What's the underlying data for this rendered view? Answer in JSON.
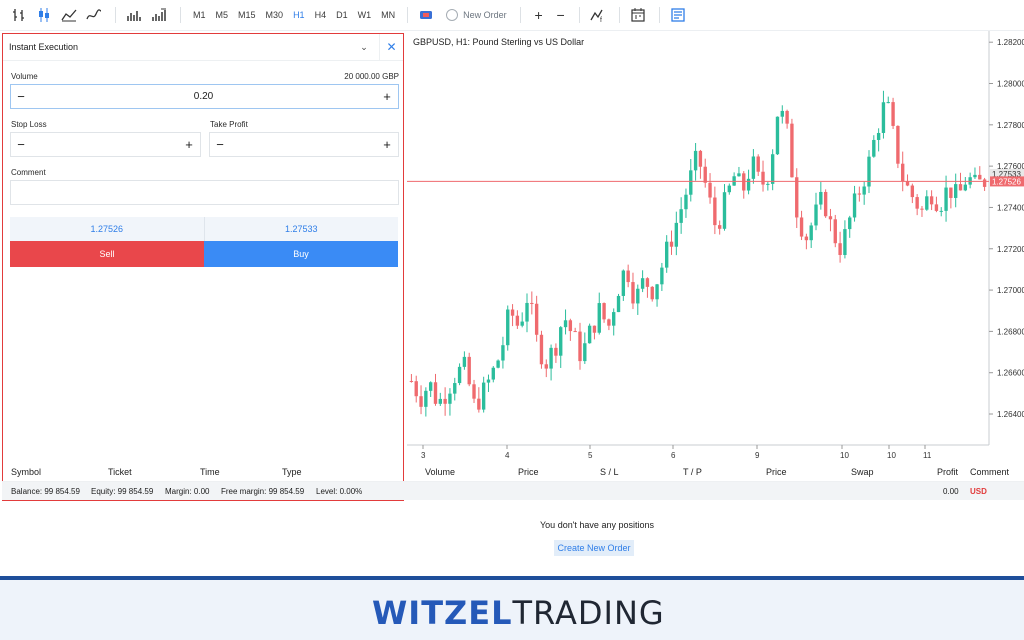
{
  "toolbar": {
    "timeframes": [
      "M1",
      "M5",
      "M15",
      "M30",
      "H1",
      "H4",
      "D1",
      "W1",
      "MN"
    ],
    "active_timeframe": "H1",
    "new_order_label": "New Order"
  },
  "panel": {
    "title": "Instant Execution",
    "volume_label": "Volume",
    "volume_amount": "20 000.00 GBP",
    "volume_value": "0.20",
    "stop_loss_label": "Stop Loss",
    "take_profit_label": "Take Profit",
    "comment_label": "Comment",
    "bid": "1.27526",
    "ask": "1.27533",
    "sell_label": "Sell",
    "buy_label": "Buy"
  },
  "chart_data": {
    "type": "candlestick",
    "title": "GBPUSD, H1: Pound Sterling vs US Dollar",
    "x_ticks": [
      "3",
      "4",
      "5",
      "6",
      "9",
      "10",
      "10",
      "11"
    ],
    "y_ticks": [
      "1.28200",
      "1.28000",
      "1.27800",
      "1.27600",
      "1.27400",
      "1.27200",
      "1.27000",
      "1.26800",
      "1.26600",
      "1.26400"
    ],
    "ylim": [
      1.2625,
      1.2823
    ],
    "price_labels": {
      "ask": "1.27533",
      "bid": "1.27526"
    },
    "up_color": "#2bbd9c",
    "down_color": "#ef6a6e",
    "close_path": [
      1.2656,
      1.2648,
      1.2655,
      1.2645,
      1.2652,
      1.266,
      1.2662,
      1.2644,
      1.265,
      1.2659,
      1.267,
      1.269,
      1.2682,
      1.2698,
      1.2675,
      1.2665,
      1.2672,
      1.2688,
      1.2678,
      1.2668,
      1.268,
      1.269,
      1.2682,
      1.27,
      1.2712,
      1.2695,
      1.2705,
      1.27,
      1.2712,
      1.2725,
      1.2738,
      1.2752,
      1.2765,
      1.2748,
      1.273,
      1.2742,
      1.2755,
      1.2748,
      1.2762,
      1.275,
      1.2758,
      1.279,
      1.2775,
      1.274,
      1.2725,
      1.2735,
      1.2745,
      1.2728,
      1.272,
      1.2735,
      1.2748,
      1.276,
      1.2778,
      1.2792,
      1.277,
      1.2752,
      1.2745,
      1.2738,
      1.2748,
      1.2742,
      1.275,
      1.2744,
      1.2755,
      1.275,
      1.2753
    ]
  },
  "positions": {
    "left_headers": [
      "Symbol",
      "Ticket",
      "Time",
      "Type"
    ],
    "right_headers": [
      "Volume",
      "Price",
      "S / L",
      "T / P",
      "Price",
      "Swap",
      "Profit",
      "Comment"
    ],
    "balance": "Balance: 99 854.59",
    "equity": "Equity: 99 854.59",
    "margin": "Margin: 0.00",
    "free_margin": "Free margin: 99 854.59",
    "level": "Level: 0.00%",
    "profit": "0.00",
    "currency": "USD",
    "empty_message": "You don't have any positions",
    "create_label": "Create New Order"
  },
  "brand": {
    "part1": "WITZEL",
    "part2": "TRADING",
    "accent": "#2559b8"
  }
}
